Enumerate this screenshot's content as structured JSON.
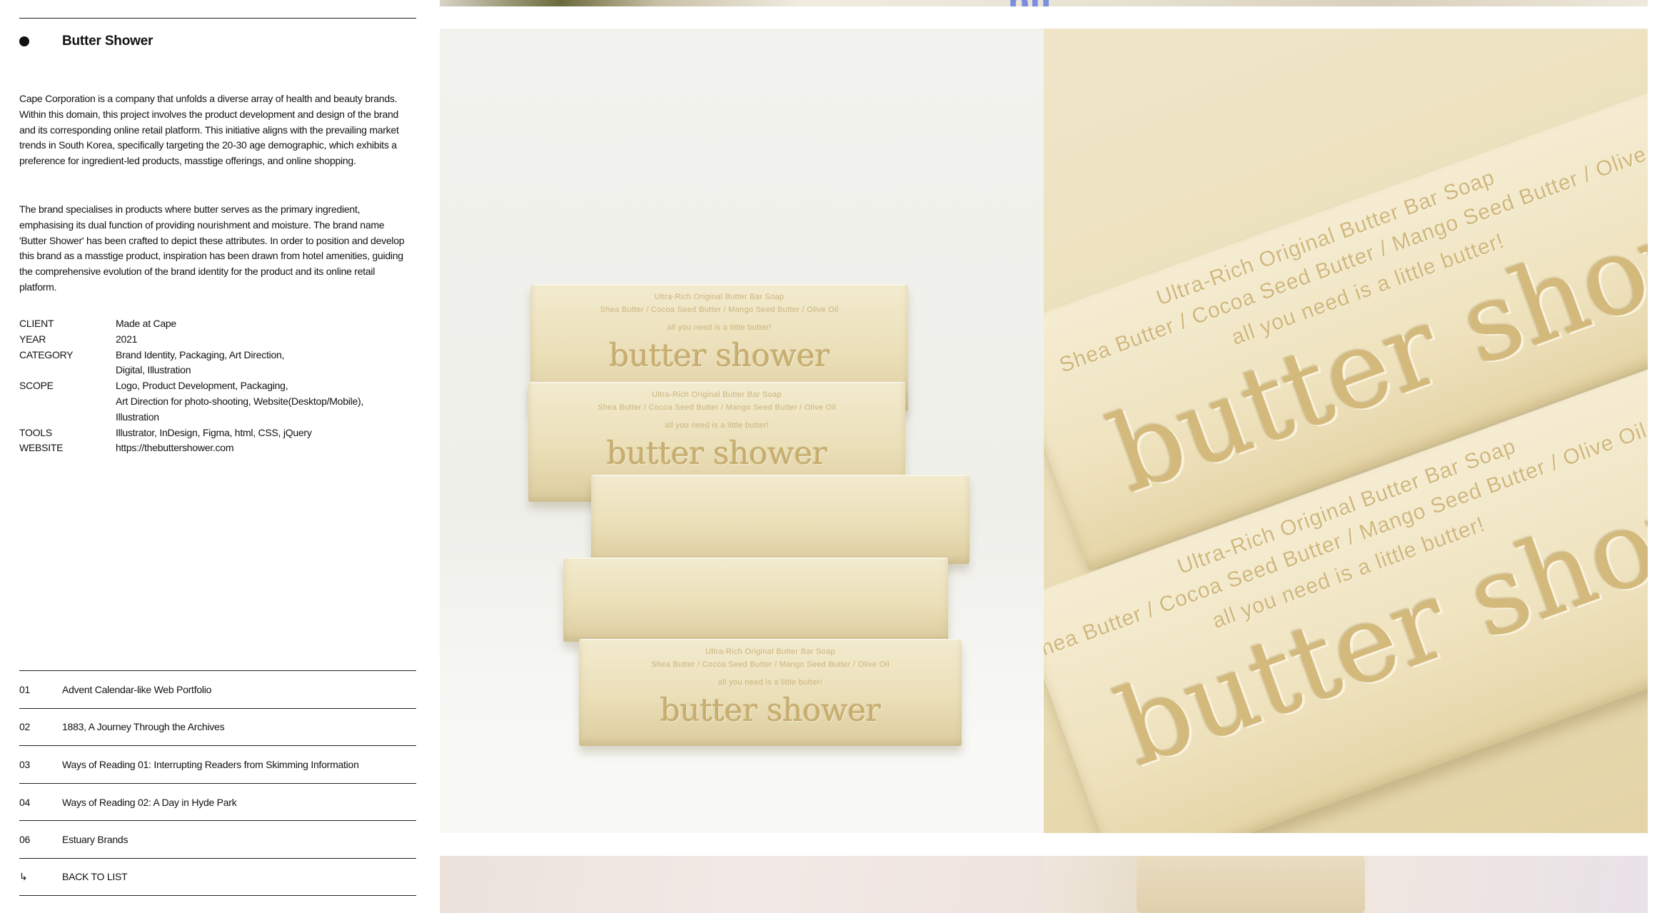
{
  "project": {
    "title": "Butter Shower",
    "description": [
      "Cape Corporation is a company that unfolds a diverse array of health and beauty brands. Within this domain, this project involves the product development and design of the brand and its corresponding online retail platform. This initiative aligns with the prevailing market trends in South Korea, specifically targeting the 20-30 age demographic, which exhibits a preference for ingredient-led products, masstige offerings, and online shopping.",
      "The brand specialises in products where butter serves as the primary ingredient, emphasising its dual function of providing nourishment and moisture. The brand name 'Butter Shower' has been crafted to depict these attributes. In order to position and develop this brand as a masstige product, inspiration has been drawn from hotel amenities, guiding the comprehensive evolution of the brand identity for the product and its online retail platform."
    ]
  },
  "meta": [
    {
      "key": "CLIENT",
      "value": "Made at Cape"
    },
    {
      "key": "YEAR",
      "value": "2021"
    },
    {
      "key": "CATEGORY",
      "value": "Brand Identity, Packaging, Art Direction,\nDigital, Illustration"
    },
    {
      "key": "SCOPE",
      "value": "Logo, Product Development, Packaging,\nArt Direction for photo-shooting, Website(Desktop/Mobile),\nIllustration"
    },
    {
      "key": "TOOLS",
      "value": "Illustrator, InDesign, Figma, html, CSS, jQuery"
    },
    {
      "key": "WEBSITE",
      "value": "https://thebuttershower.com"
    }
  ],
  "other_projects": [
    {
      "num": "01",
      "title": "Advent Calendar-like Web Portfolio"
    },
    {
      "num": "02",
      "title": "1883, A Journey Through the Archives"
    },
    {
      "num": "03",
      "title": "Ways of Reading 01: Interrupting Readers from Skimming Information"
    },
    {
      "num": "04",
      "title": "Ways of Reading 02: A Day in Hyde Park"
    },
    {
      "num": "06",
      "title": "Estuary Brands"
    },
    {
      "num": "↳",
      "title": "BACK TO LIST"
    }
  ],
  "gallery": {
    "soap": {
      "line1": "Ultra-Rich Original Butter Bar Soap",
      "line2": "Shea Butter / Cocoa Seed Butter / Mango Seed Butter / Olive Oil",
      "line3": "all you need is a little butter!",
      "brand": "butter shower"
    },
    "closeup": {
      "line1": "Ultra-Rich Original Butter Bar Soap",
      "line2": "Shea Butter / Cocoa Seed Butter / Mango Seed Butter / Olive Oil",
      "line3": "all you need is a little butter!",
      "brand": "butter shower"
    }
  }
}
